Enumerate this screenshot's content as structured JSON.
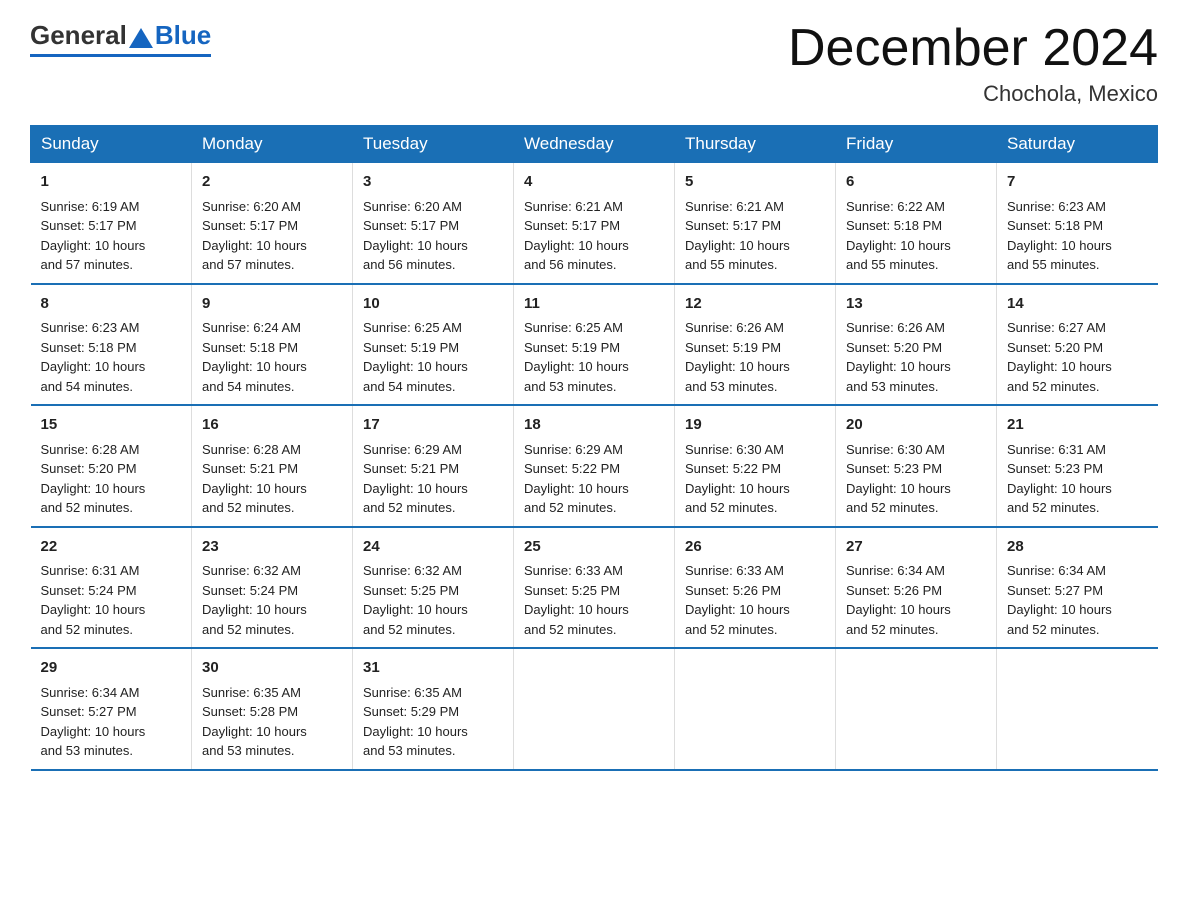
{
  "header": {
    "logo_general": "General",
    "logo_blue": "Blue",
    "month_title": "December 2024",
    "location": "Chochola, Mexico"
  },
  "weekdays": [
    "Sunday",
    "Monday",
    "Tuesday",
    "Wednesday",
    "Thursday",
    "Friday",
    "Saturday"
  ],
  "weeks": [
    [
      {
        "day": "1",
        "sunrise": "6:19 AM",
        "sunset": "5:17 PM",
        "daylight": "10 hours and 57 minutes."
      },
      {
        "day": "2",
        "sunrise": "6:20 AM",
        "sunset": "5:17 PM",
        "daylight": "10 hours and 57 minutes."
      },
      {
        "day": "3",
        "sunrise": "6:20 AM",
        "sunset": "5:17 PM",
        "daylight": "10 hours and 56 minutes."
      },
      {
        "day": "4",
        "sunrise": "6:21 AM",
        "sunset": "5:17 PM",
        "daylight": "10 hours and 56 minutes."
      },
      {
        "day": "5",
        "sunrise": "6:21 AM",
        "sunset": "5:17 PM",
        "daylight": "10 hours and 55 minutes."
      },
      {
        "day": "6",
        "sunrise": "6:22 AM",
        "sunset": "5:18 PM",
        "daylight": "10 hours and 55 minutes."
      },
      {
        "day": "7",
        "sunrise": "6:23 AM",
        "sunset": "5:18 PM",
        "daylight": "10 hours and 55 minutes."
      }
    ],
    [
      {
        "day": "8",
        "sunrise": "6:23 AM",
        "sunset": "5:18 PM",
        "daylight": "10 hours and 54 minutes."
      },
      {
        "day": "9",
        "sunrise": "6:24 AM",
        "sunset": "5:18 PM",
        "daylight": "10 hours and 54 minutes."
      },
      {
        "day": "10",
        "sunrise": "6:25 AM",
        "sunset": "5:19 PM",
        "daylight": "10 hours and 54 minutes."
      },
      {
        "day": "11",
        "sunrise": "6:25 AM",
        "sunset": "5:19 PM",
        "daylight": "10 hours and 53 minutes."
      },
      {
        "day": "12",
        "sunrise": "6:26 AM",
        "sunset": "5:19 PM",
        "daylight": "10 hours and 53 minutes."
      },
      {
        "day": "13",
        "sunrise": "6:26 AM",
        "sunset": "5:20 PM",
        "daylight": "10 hours and 53 minutes."
      },
      {
        "day": "14",
        "sunrise": "6:27 AM",
        "sunset": "5:20 PM",
        "daylight": "10 hours and 52 minutes."
      }
    ],
    [
      {
        "day": "15",
        "sunrise": "6:28 AM",
        "sunset": "5:20 PM",
        "daylight": "10 hours and 52 minutes."
      },
      {
        "day": "16",
        "sunrise": "6:28 AM",
        "sunset": "5:21 PM",
        "daylight": "10 hours and 52 minutes."
      },
      {
        "day": "17",
        "sunrise": "6:29 AM",
        "sunset": "5:21 PM",
        "daylight": "10 hours and 52 minutes."
      },
      {
        "day": "18",
        "sunrise": "6:29 AM",
        "sunset": "5:22 PM",
        "daylight": "10 hours and 52 minutes."
      },
      {
        "day": "19",
        "sunrise": "6:30 AM",
        "sunset": "5:22 PM",
        "daylight": "10 hours and 52 minutes."
      },
      {
        "day": "20",
        "sunrise": "6:30 AM",
        "sunset": "5:23 PM",
        "daylight": "10 hours and 52 minutes."
      },
      {
        "day": "21",
        "sunrise": "6:31 AM",
        "sunset": "5:23 PM",
        "daylight": "10 hours and 52 minutes."
      }
    ],
    [
      {
        "day": "22",
        "sunrise": "6:31 AM",
        "sunset": "5:24 PM",
        "daylight": "10 hours and 52 minutes."
      },
      {
        "day": "23",
        "sunrise": "6:32 AM",
        "sunset": "5:24 PM",
        "daylight": "10 hours and 52 minutes."
      },
      {
        "day": "24",
        "sunrise": "6:32 AM",
        "sunset": "5:25 PM",
        "daylight": "10 hours and 52 minutes."
      },
      {
        "day": "25",
        "sunrise": "6:33 AM",
        "sunset": "5:25 PM",
        "daylight": "10 hours and 52 minutes."
      },
      {
        "day": "26",
        "sunrise": "6:33 AM",
        "sunset": "5:26 PM",
        "daylight": "10 hours and 52 minutes."
      },
      {
        "day": "27",
        "sunrise": "6:34 AM",
        "sunset": "5:26 PM",
        "daylight": "10 hours and 52 minutes."
      },
      {
        "day": "28",
        "sunrise": "6:34 AM",
        "sunset": "5:27 PM",
        "daylight": "10 hours and 52 minutes."
      }
    ],
    [
      {
        "day": "29",
        "sunrise": "6:34 AM",
        "sunset": "5:27 PM",
        "daylight": "10 hours and 53 minutes."
      },
      {
        "day": "30",
        "sunrise": "6:35 AM",
        "sunset": "5:28 PM",
        "daylight": "10 hours and 53 minutes."
      },
      {
        "day": "31",
        "sunrise": "6:35 AM",
        "sunset": "5:29 PM",
        "daylight": "10 hours and 53 minutes."
      },
      {
        "day": "",
        "sunrise": "",
        "sunset": "",
        "daylight": ""
      },
      {
        "day": "",
        "sunrise": "",
        "sunset": "",
        "daylight": ""
      },
      {
        "day": "",
        "sunrise": "",
        "sunset": "",
        "daylight": ""
      },
      {
        "day": "",
        "sunrise": "",
        "sunset": "",
        "daylight": ""
      }
    ]
  ],
  "labels": {
    "sunrise": "Sunrise:",
    "sunset": "Sunset:",
    "daylight": "Daylight:"
  }
}
